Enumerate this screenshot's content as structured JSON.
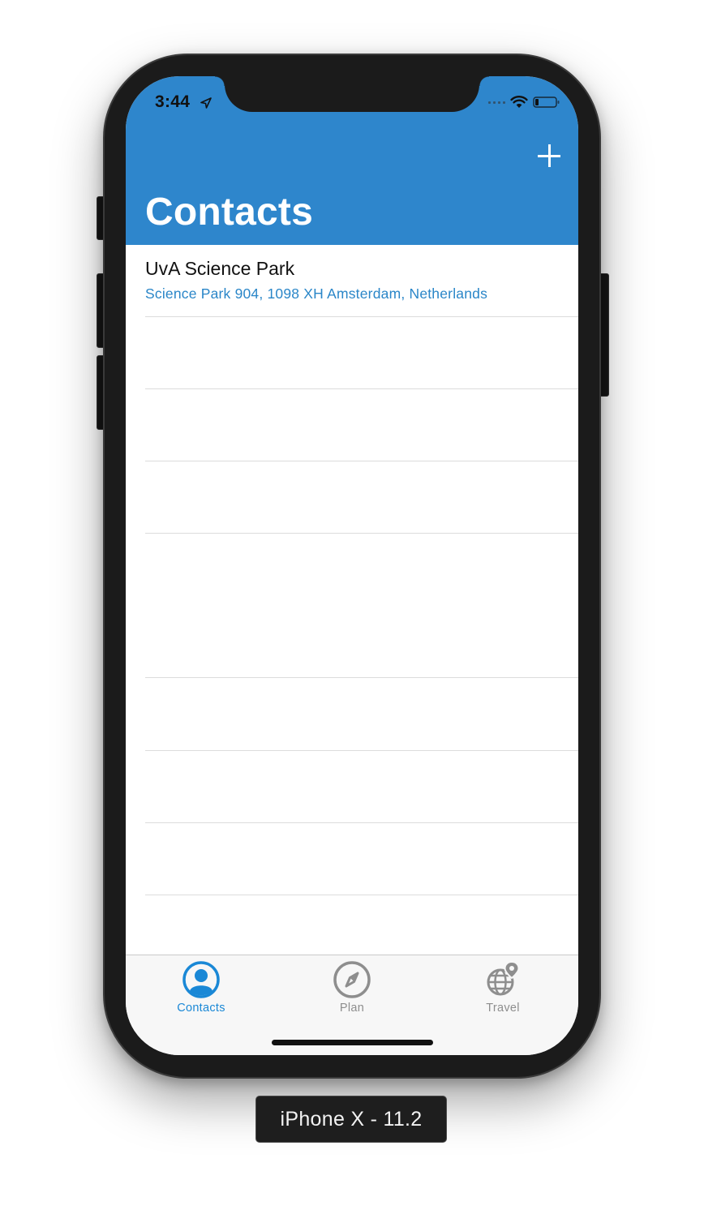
{
  "status_bar": {
    "time": "3:44",
    "location_icon": "location-arrow-icon",
    "wifi_icon": "wifi-icon",
    "battery_icon": "battery-icon"
  },
  "nav": {
    "title": "Contacts",
    "add_icon": "plus-icon",
    "background_color": "#2e86cc"
  },
  "contacts": [
    {
      "name": "UvA Science Park",
      "address": "Science Park 904, 1098 XH Amsterdam, Netherlands"
    }
  ],
  "tabs": [
    {
      "label": "Contacts",
      "icon": "person-circle-icon",
      "active": true,
      "color": "#1a88d6"
    },
    {
      "label": "Plan",
      "icon": "compass-icon",
      "active": false,
      "color": "#8e8e8e"
    },
    {
      "label": "Travel",
      "icon": "globe-pin-icon",
      "active": false,
      "color": "#8e8e8e"
    }
  ],
  "device_label": "iPhone X - 11.2"
}
